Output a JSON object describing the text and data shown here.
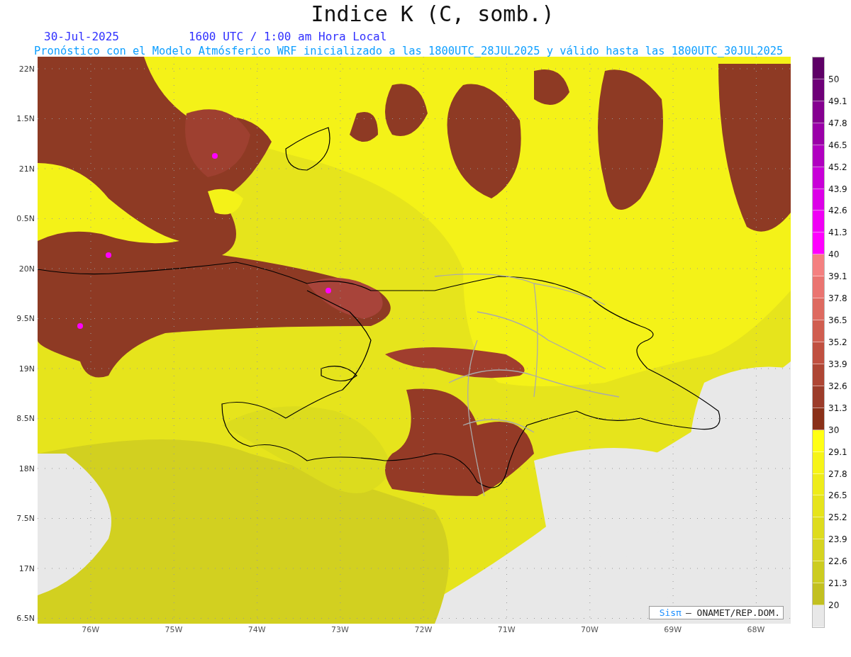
{
  "title": "Indice K (C, somb.)",
  "date": "30-Jul-2025",
  "time": "1600 UTC / 1:00 am Hora Local",
  "subtitle": "Pronóstico con el Modelo Atmósferico WRF inicializado a las 1800UTC_28JUL2025 y válido hasta las  1800UTC_30JUL2025",
  "y_axis": [
    "22N",
    "1.5N",
    "21N",
    "0.5N",
    "20N",
    "9.5N",
    "19N",
    "8.5N",
    "18N",
    "7.5N",
    "17N",
    "6.5N"
  ],
  "x_axis": [
    "76W",
    "75W",
    "74W",
    "73W",
    "72W",
    "71W",
    "70W",
    "69W",
    "68W"
  ],
  "credit": {
    "logo": "Sisπ",
    "text": "– ONAMET/REP.DOM."
  },
  "colorbar": [
    {
      "color": "#5e0066",
      "label": "50"
    },
    {
      "color": "#6e0078",
      "label": "49.1"
    },
    {
      "color": "#850090",
      "label": "47.8"
    },
    {
      "color": "#9a00a8",
      "label": "46.5"
    },
    {
      "color": "#b000c0",
      "label": "45.2"
    },
    {
      "color": "#c800d8",
      "label": "43.9"
    },
    {
      "color": "#dc00e8",
      "label": "42.6"
    },
    {
      "color": "#f000f5",
      "label": "41.3"
    },
    {
      "color": "#ff00ff",
      "label": "40"
    },
    {
      "color": "#f48080",
      "label": "39.1"
    },
    {
      "color": "#ea7470",
      "label": "37.8"
    },
    {
      "color": "#de6a60",
      "label": "36.5"
    },
    {
      "color": "#d05e50",
      "label": "35.2"
    },
    {
      "color": "#c05040",
      "label": "33.9"
    },
    {
      "color": "#ae4634",
      "label": "32.6"
    },
    {
      "color": "#9c3c2a",
      "label": "31.3"
    },
    {
      "color": "#8a3018",
      "label": "30"
    },
    {
      "color": "#ffff14",
      "label": "29.1"
    },
    {
      "color": "#f6f418",
      "label": "27.8"
    },
    {
      "color": "#eeec1a",
      "label": "26.5"
    },
    {
      "color": "#e6e41c",
      "label": "25.2"
    },
    {
      "color": "#dedc1e",
      "label": "23.9"
    },
    {
      "color": "#d6d420",
      "label": "22.6"
    },
    {
      "color": "#cccc20",
      "label": "21.3"
    },
    {
      "color": "#c2c020",
      "label": "20"
    },
    {
      "color": "#e8e8e8"
    }
  ]
}
